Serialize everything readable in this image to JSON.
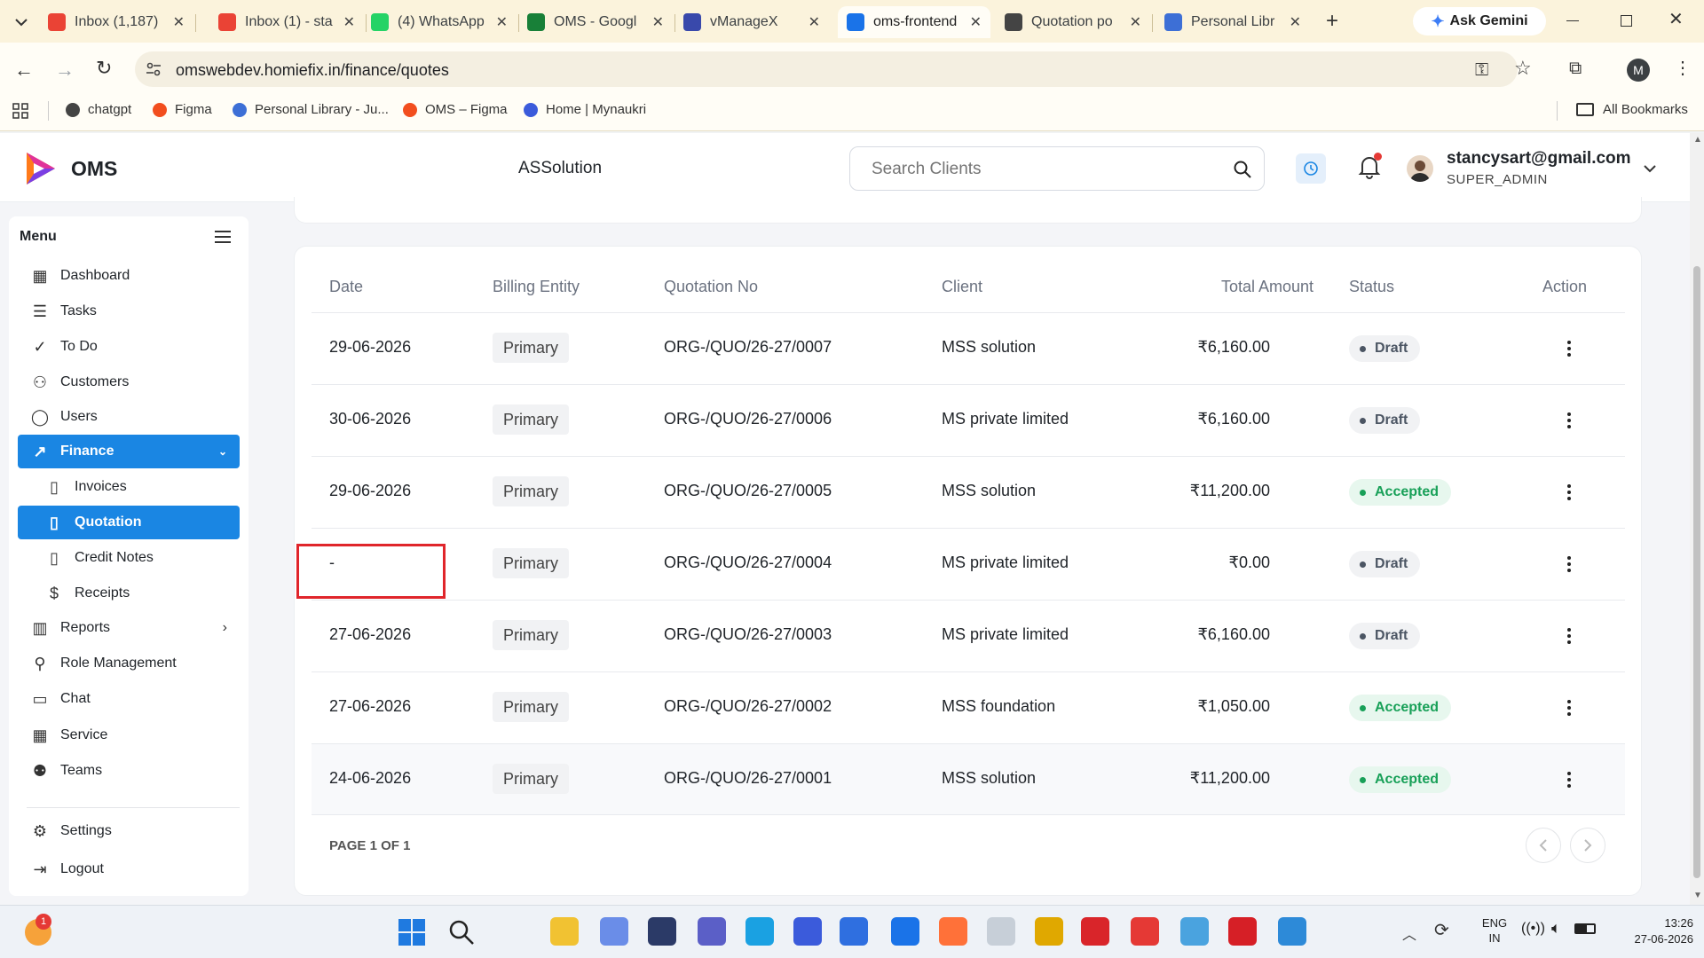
{
  "browser": {
    "tabs": [
      {
        "title": "Inbox (1,187)",
        "icon": "gmail-icon",
        "color": "#ea4335"
      },
      {
        "title": "Inbox (1) - sta",
        "icon": "gmail-icon",
        "color": "#ea4335"
      },
      {
        "title": "(4) WhatsApp",
        "icon": "whatsapp-icon",
        "color": "#25d366"
      },
      {
        "title": "OMS - Googl",
        "icon": "google-sheets-icon",
        "color": "#188038"
      },
      {
        "title": "vManageX",
        "icon": "vmanagex-icon",
        "color": "#3949ab"
      },
      {
        "title": "oms-frontend",
        "icon": "docs-icon",
        "color": "#1a73e8"
      },
      {
        "title": "Quotation po",
        "icon": "chatgpt-icon",
        "color": "#444444"
      },
      {
        "title": "Personal Libr",
        "icon": "library-icon",
        "color": "#3d6fd6"
      }
    ],
    "ask_gemini": "Ask Gemini",
    "url": "omswebdev.homiefix.in/finance/quotes",
    "profile_initial": "M",
    "bookmarks": [
      {
        "label": "chatgpt",
        "icon": "chatgpt-icon"
      },
      {
        "label": "Figma",
        "icon": "figma-icon"
      },
      {
        "label": "Personal Library - Ju...",
        "icon": "library-icon"
      },
      {
        "label": "OMS – Figma",
        "icon": "figma-icon"
      },
      {
        "label": "Home | Mynaukri",
        "icon": "naukri-icon"
      }
    ],
    "all_bookmarks": "All Bookmarks"
  },
  "app": {
    "logo_text": "OMS",
    "org_name": "ASSolution",
    "search_placeholder": "Search Clients",
    "user_email": "stancysart@gmail.com",
    "user_role": "SUPER_ADMIN"
  },
  "sidebar": {
    "title": "Menu",
    "items": [
      {
        "label": "Dashboard",
        "icon": "dashboard-icon"
      },
      {
        "label": "Tasks",
        "icon": "tasks-icon"
      },
      {
        "label": "To Do",
        "icon": "todo-icon"
      },
      {
        "label": "Customers",
        "icon": "customers-icon"
      },
      {
        "label": "Users",
        "icon": "user-icon"
      },
      {
        "label": "Finance",
        "icon": "finance-icon"
      },
      {
        "label": "Invoices",
        "icon": "document-icon"
      },
      {
        "label": "Quotation",
        "icon": "document-icon"
      },
      {
        "label": "Credit Notes",
        "icon": "document-icon"
      },
      {
        "label": "Receipts",
        "icon": "receipt-icon"
      },
      {
        "label": "Reports",
        "icon": "reports-icon"
      },
      {
        "label": "Role Management",
        "icon": "role-icon"
      },
      {
        "label": "Chat",
        "icon": "chat-icon"
      },
      {
        "label": "Service",
        "icon": "service-icon"
      },
      {
        "label": "Teams",
        "icon": "teams-icon"
      },
      {
        "label": "Settings",
        "icon": "settings-icon"
      },
      {
        "label": "Logout",
        "icon": "logout-icon"
      }
    ],
    "active_item": "Quotation"
  },
  "table": {
    "headers": [
      "Date",
      "Billing Entity",
      "Quotation No",
      "Client",
      "Total Amount",
      "Status",
      "Action"
    ],
    "rows": [
      {
        "date": "29-06-2026",
        "entity": "Primary",
        "number": "ORG-/QUO/26-27/0007",
        "client": "MSS solution",
        "amount": "₹6,160.00",
        "status": "Draft"
      },
      {
        "date": "30-06-2026",
        "entity": "Primary",
        "number": "ORG-/QUO/26-27/0006",
        "client": "MS private limited",
        "amount": "₹6,160.00",
        "status": "Draft"
      },
      {
        "date": "29-06-2026",
        "entity": "Primary",
        "number": "ORG-/QUO/26-27/0005",
        "client": "MSS solution",
        "amount": "₹11,200.00",
        "status": "Accepted"
      },
      {
        "date": "-",
        "entity": "Primary",
        "number": "ORG-/QUO/26-27/0004",
        "client": "MS private limited",
        "amount": "₹0.00",
        "status": "Draft"
      },
      {
        "date": "27-06-2026",
        "entity": "Primary",
        "number": "ORG-/QUO/26-27/0003",
        "client": "MS private limited",
        "amount": "₹6,160.00",
        "status": "Draft"
      },
      {
        "date": "27-06-2026",
        "entity": "Primary",
        "number": "ORG-/QUO/26-27/0002",
        "client": "MSS foundation",
        "amount": "₹1,050.00",
        "status": "Accepted"
      },
      {
        "date": "24-06-2026",
        "entity": "Primary",
        "number": "ORG-/QUO/26-27/0001",
        "client": "MSS solution",
        "amount": "₹11,200.00",
        "status": "Accepted"
      }
    ],
    "pagination": "PAGE 1 OF 1"
  },
  "colors": {
    "accent": "#1a86e3",
    "draft_bg": "#f1f2f4",
    "draft_text": "#4b5563",
    "accepted_bg": "#e7f7ee",
    "accepted_text": "#18a058",
    "highlight_border": "#e0252b"
  },
  "taskbar": {
    "time": "13:26",
    "date": "27-06-2026",
    "lang": "ENG",
    "region": "IN",
    "notification_count": "1"
  }
}
